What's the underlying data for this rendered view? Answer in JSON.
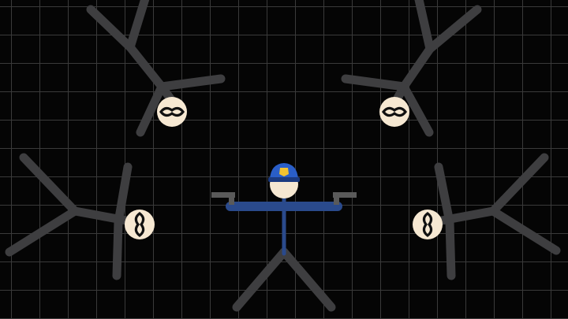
{
  "scene": {
    "name": "stickman-police-shooter",
    "background_color": "#050505",
    "grid_color": "#3a3a3a"
  },
  "colors": {
    "limb": "#3e3e40",
    "skin": "#f6e8d2",
    "mask": "#111111",
    "police_uniform": "#2a4a8c",
    "police_cap": "#2a5ec8",
    "badge": "#f2c230",
    "gun": "#5a5a5a"
  },
  "characters": {
    "police": {
      "role": "player",
      "weapon_left": "pistol",
      "weapon_right": "pistol",
      "icon": "police-cap-icon"
    },
    "enemies": [
      {
        "id": "top-left",
        "orientation": "upside-down",
        "icon": "bandit-mask-icon"
      },
      {
        "id": "top-right",
        "orientation": "upside-down",
        "icon": "bandit-mask-icon"
      },
      {
        "id": "mid-left",
        "orientation": "sideways-right",
        "icon": "bandit-mask-icon"
      },
      {
        "id": "mid-right",
        "orientation": "sideways-left",
        "icon": "bandit-mask-icon"
      }
    ]
  }
}
